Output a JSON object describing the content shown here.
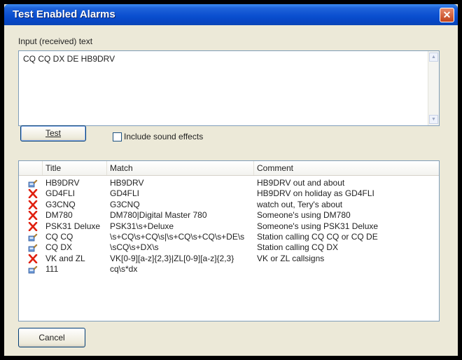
{
  "window": {
    "title": "Test Enabled Alarms",
    "close_glyph": "✕"
  },
  "input": {
    "label": "Input (received) text",
    "value": "CQ CQ DX DE HB9DRV"
  },
  "test_button": {
    "label": "Test"
  },
  "sound_checkbox": {
    "label": "Include sound effects",
    "checked": false
  },
  "table": {
    "columns": [
      "Title",
      "Match",
      "Comment"
    ],
    "rows": [
      {
        "icon": "enabled-alarm-icon",
        "title": "HB9DRV",
        "match": "HB9DRV",
        "comment": "HB9DRV out and about"
      },
      {
        "icon": "no-match-x-icon",
        "title": "GD4FLI",
        "match": "GD4FLI",
        "comment": "HB9DRV on holiday as GD4FLI"
      },
      {
        "icon": "no-match-x-icon",
        "title": "G3CNQ",
        "match": "G3CNQ",
        "comment": "watch out, Tery's about"
      },
      {
        "icon": "no-match-x-icon",
        "title": "DM780",
        "match": "DM780|Digital Master 780",
        "comment": "Someone's using DM780"
      },
      {
        "icon": "no-match-x-icon",
        "title": "PSK31 Deluxe",
        "match": "PSK31\\s+Deluxe",
        "comment": "Someone's using PSK31 Deluxe"
      },
      {
        "icon": "enabled-alarm-icon",
        "title": "CQ CQ",
        "match": "\\s+CQ\\s+CQ\\s|\\s+CQ\\s+CQ\\s+DE\\s",
        "comment": "Station calling CQ CQ or CQ DE"
      },
      {
        "icon": "enabled-alarm-icon",
        "title": "CQ DX",
        "match": "\\sCQ\\s+DX\\s",
        "comment": "Station calling CQ DX"
      },
      {
        "icon": "no-match-x-icon",
        "title": "VK and ZL",
        "match": "VK[0-9][a-z]{2,3}|ZL[0-9][a-z]{2,3}",
        "comment": "VK or ZL callsigns"
      },
      {
        "icon": "enabled-alarm-icon",
        "title": "111",
        "match": "cq\\s*dx",
        "comment": ""
      }
    ]
  },
  "cancel_button": {
    "label": "Cancel"
  },
  "colors": {
    "title_blue": "#0a4fd0",
    "close_red": "#c1421b",
    "x_red": "#e0200f",
    "dialog_bg": "#ece9d8"
  }
}
